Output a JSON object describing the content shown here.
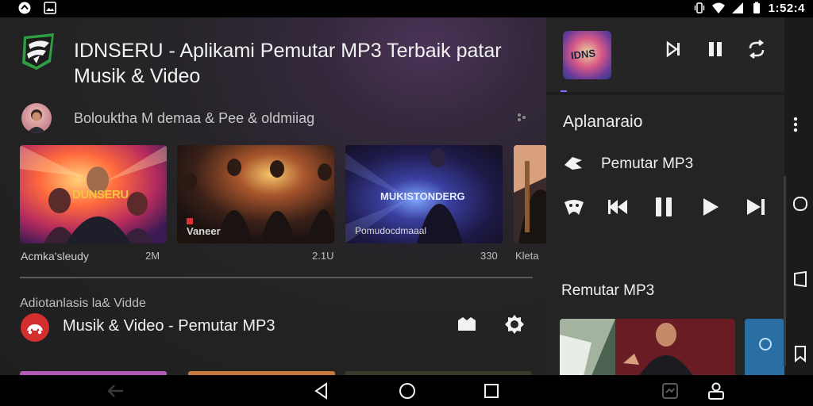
{
  "status_bar": {
    "time": "1:52:4",
    "icons": [
      "notification-icon",
      "image-icon",
      "vibrate-icon",
      "wifi-icon",
      "signal-icon",
      "battery-icon"
    ]
  },
  "header": {
    "title": "IDNSERU - Aplikami Pemutar MP3 Terbaik patar Musik & Video"
  },
  "channel": {
    "name": "Bolouktha M demaa & Pee & oldmiiag"
  },
  "videos": [
    {
      "caption": "DUNSERU",
      "overlay": "",
      "title": "Acmka'sleudy",
      "count": "2M"
    },
    {
      "caption": "",
      "overlay": "Vaneer",
      "title": "",
      "count": "2.1U"
    },
    {
      "caption": "MUKISTONDERG",
      "overlay": "Pomudocdmaaal",
      "title": "",
      "count": "330"
    },
    {
      "caption": "",
      "overlay": "",
      "title": "Kleta",
      "count": ""
    }
  ],
  "section": {
    "label": "Adiotanlasis la& Vidde",
    "title": "Musik & Video - Pemutar MP3"
  },
  "mini_player": {
    "art_text": "IDNS"
  },
  "panel": {
    "title": "Aplanaraio",
    "now_playing": "Pemutar MP3",
    "subtitle": "Remutar MP3"
  },
  "colors": {
    "accent": "#8a6cff",
    "music_icon": "#d32f2f",
    "logo_green": "#35b24a"
  }
}
